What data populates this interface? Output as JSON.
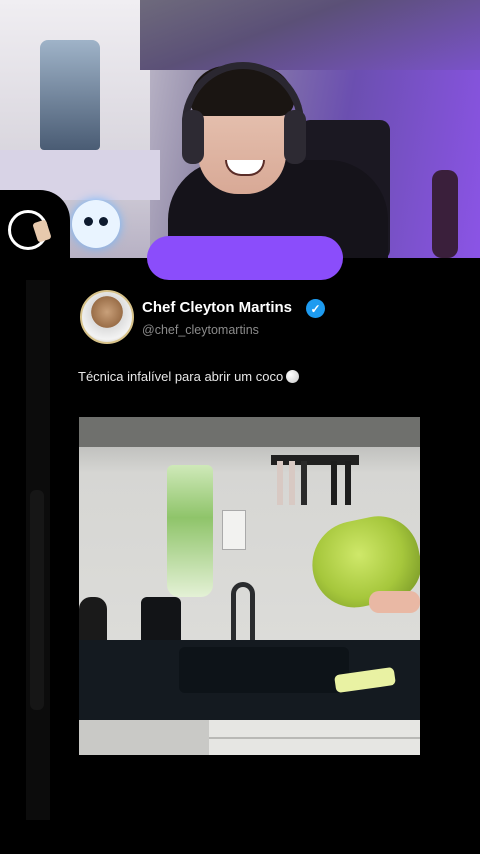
{
  "overlay": {
    "purple_bar_color": "#8b4dfb"
  },
  "post": {
    "author_name": "Chef Cleyton Martins",
    "author_handle": "@chef_cleytomartins",
    "verified": true,
    "caption": "Técnica infalível para abrir um coco",
    "caption_emoji": "coconut-icon"
  },
  "colors": {
    "verified_badge": "#1d9bf0",
    "background": "#000000"
  }
}
